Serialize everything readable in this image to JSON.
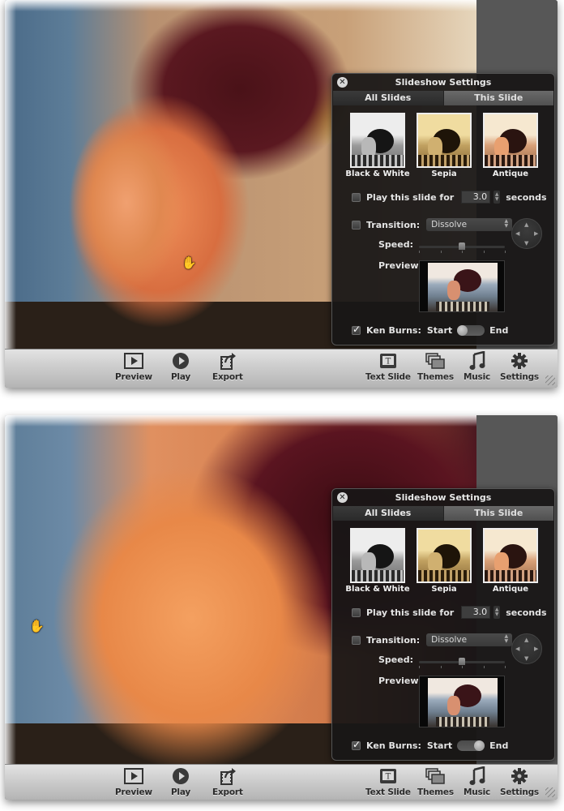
{
  "screens": [
    {
      "id": "before",
      "ken_burns_position": "start",
      "cursor": "open-hand"
    },
    {
      "id": "after",
      "ken_burns_position": "end",
      "cursor": "open-hand"
    }
  ],
  "toolbar": {
    "left_buttons": [
      {
        "label": "Preview",
        "icon": "preview-icon"
      },
      {
        "label": "Play",
        "icon": "play-icon"
      },
      {
        "label": "Export",
        "icon": "export-icon"
      }
    ],
    "right_buttons": [
      {
        "label": "Text Slide",
        "icon": "text-slide-icon"
      },
      {
        "label": "Themes",
        "icon": "themes-icon"
      },
      {
        "label": "Music",
        "icon": "music-icon"
      },
      {
        "label": "Settings",
        "icon": "gear-icon"
      }
    ]
  },
  "settings": {
    "title": "Slideshow Settings",
    "tabs": [
      {
        "label": "All Slides",
        "active": true
      },
      {
        "label": "This Slide",
        "active": false
      }
    ],
    "effects": [
      {
        "label": "Black & White"
      },
      {
        "label": "Sepia"
      },
      {
        "label": "Antique"
      }
    ],
    "play_slide": {
      "label": "Play this slide for",
      "checked": false,
      "value": "3.0",
      "unit": "seconds"
    },
    "transition": {
      "label": "Transition:",
      "checked": false,
      "value": "Dissolve"
    },
    "speed": {
      "label": "Speed:",
      "value_fraction": 0.5,
      "ticks": 5
    },
    "preview_label": "Preview:",
    "ken_burns": {
      "label": "Ken Burns:",
      "checked": true,
      "start_label": "Start",
      "end_label": "End"
    }
  },
  "glyphs": {
    "close": "✕",
    "hand": "✋",
    "stepper_up": "▲",
    "stepper_down": "▼",
    "dpad_up": "▲",
    "dpad_down": "▼",
    "dpad_left": "◀",
    "dpad_right": "▶",
    "music_note": "♫",
    "text_t": "T"
  }
}
